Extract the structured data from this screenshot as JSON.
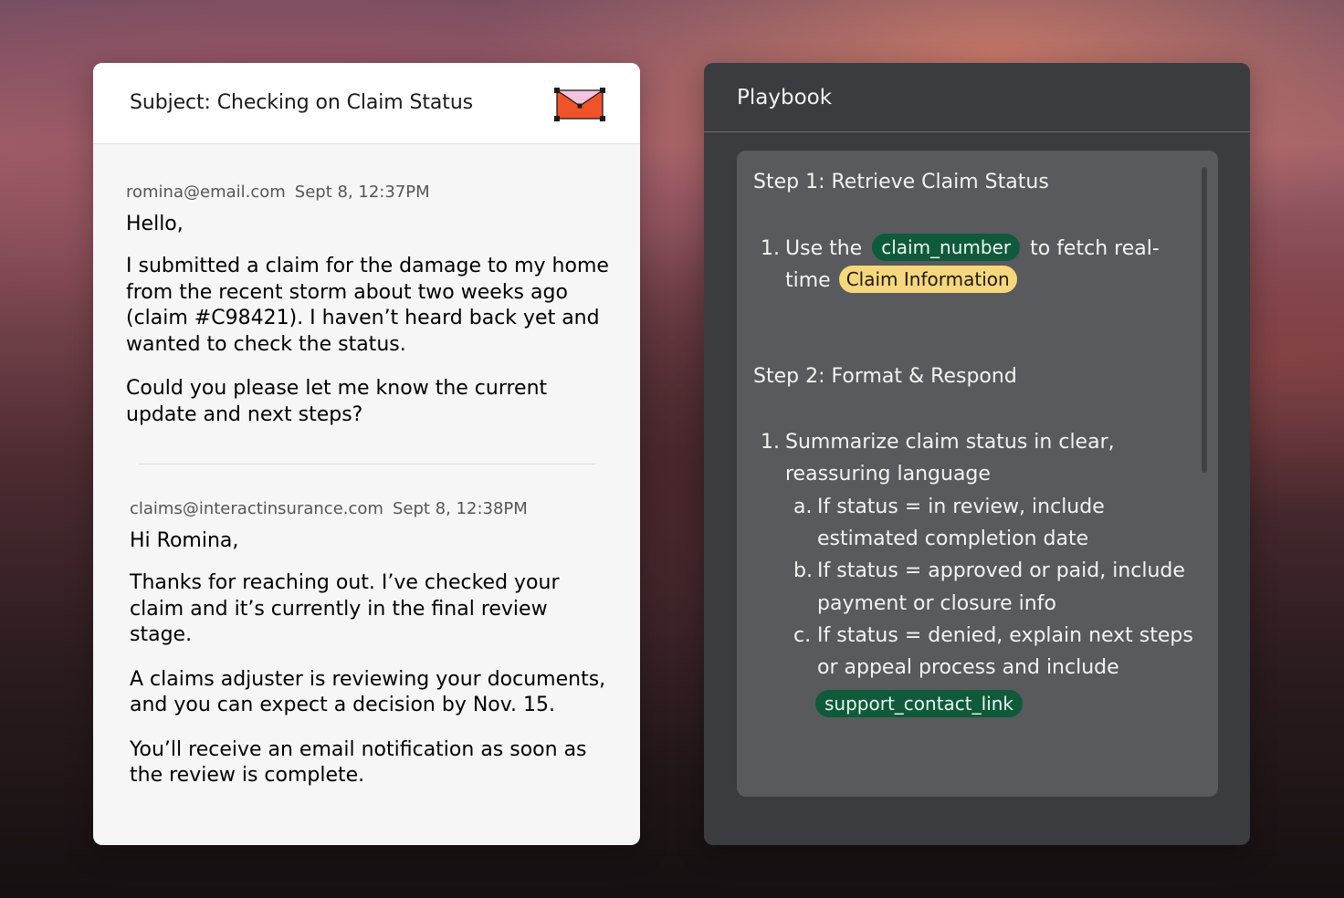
{
  "email": {
    "subject": "Subject: Checking on Claim Status",
    "icon": "mail-icon",
    "messages": [
      {
        "sender": "romina@email.com",
        "date": "Sept 8, 12:37PM",
        "greeting": "Hello,",
        "paragraphs": [
          "I submitted a claim for the damage to my home from the recent storm about two weeks ago (claim #C98421). I haven’t heard back yet and wanted to check the status.",
          "Could you please let me know the current update and next steps?"
        ]
      },
      {
        "sender": "claims@interactinsurance.com",
        "date": "Sept 8, 12:38PM",
        "greeting": "Hi Romina,",
        "paragraphs": [
          "Thanks for reaching out. I’ve checked your claim and it’s currently in the final review stage.",
          "A claims adjuster is reviewing your documents, and you can expect a decision by Nov. 15.",
          "You’ll receive an email notification as soon as the review is complete."
        ]
      }
    ]
  },
  "playbook": {
    "title": "Playbook",
    "steps": [
      {
        "title": "Step 1: Retrieve Claim Status",
        "item_number": "1.",
        "line1_before": "Use the",
        "chip_claim_number": "claim_number",
        "line1_after": "to fetch real-",
        "line2_before": "time",
        "chip_claim_information": "Claim Information"
      },
      {
        "title": "Step 2: Format & Respond",
        "item_number": "1.",
        "item_line1": "Summarize claim status in clear,",
        "item_line2": "reassuring language",
        "sub_items": [
          {
            "letter": "a.",
            "line1": "If status = in review, include",
            "line2": "estimated completion date"
          },
          {
            "letter": "b.",
            "line1": "If status = approved or paid, include",
            "line2": "payment or closure info"
          },
          {
            "letter": "c.",
            "line1": "If status = denied, explain next steps",
            "line2": "or appeal process and include"
          }
        ],
        "chip_support_link": "support_contact_link"
      }
    ],
    "colors": {
      "chip_green": "#0f5a3a",
      "chip_yellow": "#f6d77c",
      "mail_icon_orange": "#f0532a",
      "mail_icon_pink": "#f3c3df"
    }
  }
}
